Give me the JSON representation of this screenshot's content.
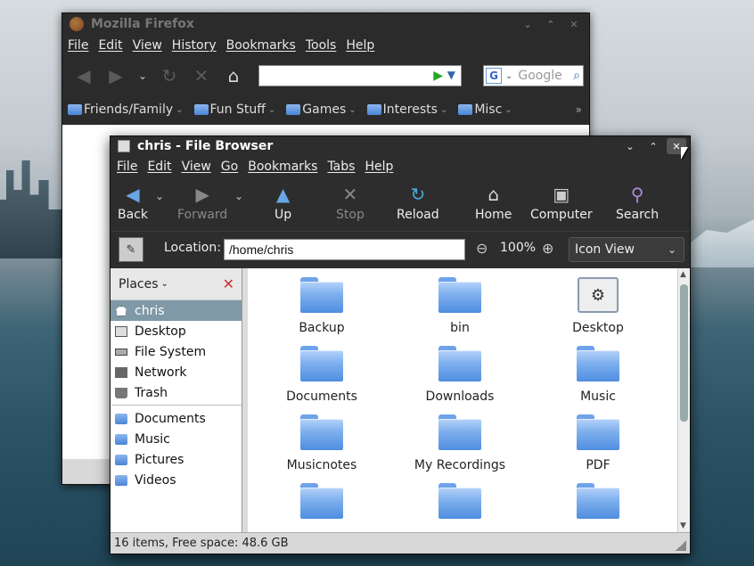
{
  "firefox": {
    "title": "Mozilla Firefox",
    "menu": [
      "File",
      "Edit",
      "View",
      "History",
      "Bookmarks",
      "Tools",
      "Help"
    ],
    "url_value": "",
    "search_placeholder": "Google",
    "bookmarks": [
      "Friends/Family",
      "Fun Stuff",
      "Games",
      "Interests",
      "Misc"
    ],
    "overflow": "»"
  },
  "filebrowser": {
    "title": "chris - File Browser",
    "menu": [
      "File",
      "Edit",
      "View",
      "Go",
      "Bookmarks",
      "Tabs",
      "Help"
    ],
    "toolbar": {
      "back": "Back",
      "forward": "Forward",
      "up": "Up",
      "stop": "Stop",
      "reload": "Reload",
      "home": "Home",
      "computer": "Computer",
      "search": "Search"
    },
    "location": {
      "label": "Location:",
      "value": "/home/chris",
      "zoom": "100%",
      "view_mode": "Icon View"
    },
    "sidebar": {
      "header": "Places",
      "places": [
        {
          "label": "chris",
          "icon": "home-icon",
          "selected": true
        },
        {
          "label": "Desktop",
          "icon": "desktop-icon"
        },
        {
          "label": "File System",
          "icon": "drive-icon"
        },
        {
          "label": "Network",
          "icon": "network-icon"
        },
        {
          "label": "Trash",
          "icon": "trash-icon"
        }
      ],
      "bookmarks": [
        "Documents",
        "Music",
        "Pictures",
        "Videos"
      ]
    },
    "items": [
      {
        "label": "Backup",
        "icon": "folder-icon"
      },
      {
        "label": "bin",
        "icon": "folder-icon"
      },
      {
        "label": "Desktop",
        "icon": "desktop-folder-icon"
      },
      {
        "label": "Documents",
        "icon": "folder-icon"
      },
      {
        "label": "Downloads",
        "icon": "folder-icon"
      },
      {
        "label": "Music",
        "icon": "folder-icon"
      },
      {
        "label": "Musicnotes",
        "icon": "folder-icon"
      },
      {
        "label": "My Recordings",
        "icon": "folder-icon"
      },
      {
        "label": "PDF",
        "icon": "folder-icon"
      },
      {
        "label": "",
        "icon": "folder-icon"
      },
      {
        "label": "",
        "icon": "folder-icon"
      },
      {
        "label": "",
        "icon": "folder-icon"
      }
    ],
    "status": "16 items, Free space: 48.6 GB"
  },
  "colors": {
    "selection": "#7f9aa6",
    "window_bg": "#2d2d2d",
    "folder": "#4f8ee0"
  }
}
